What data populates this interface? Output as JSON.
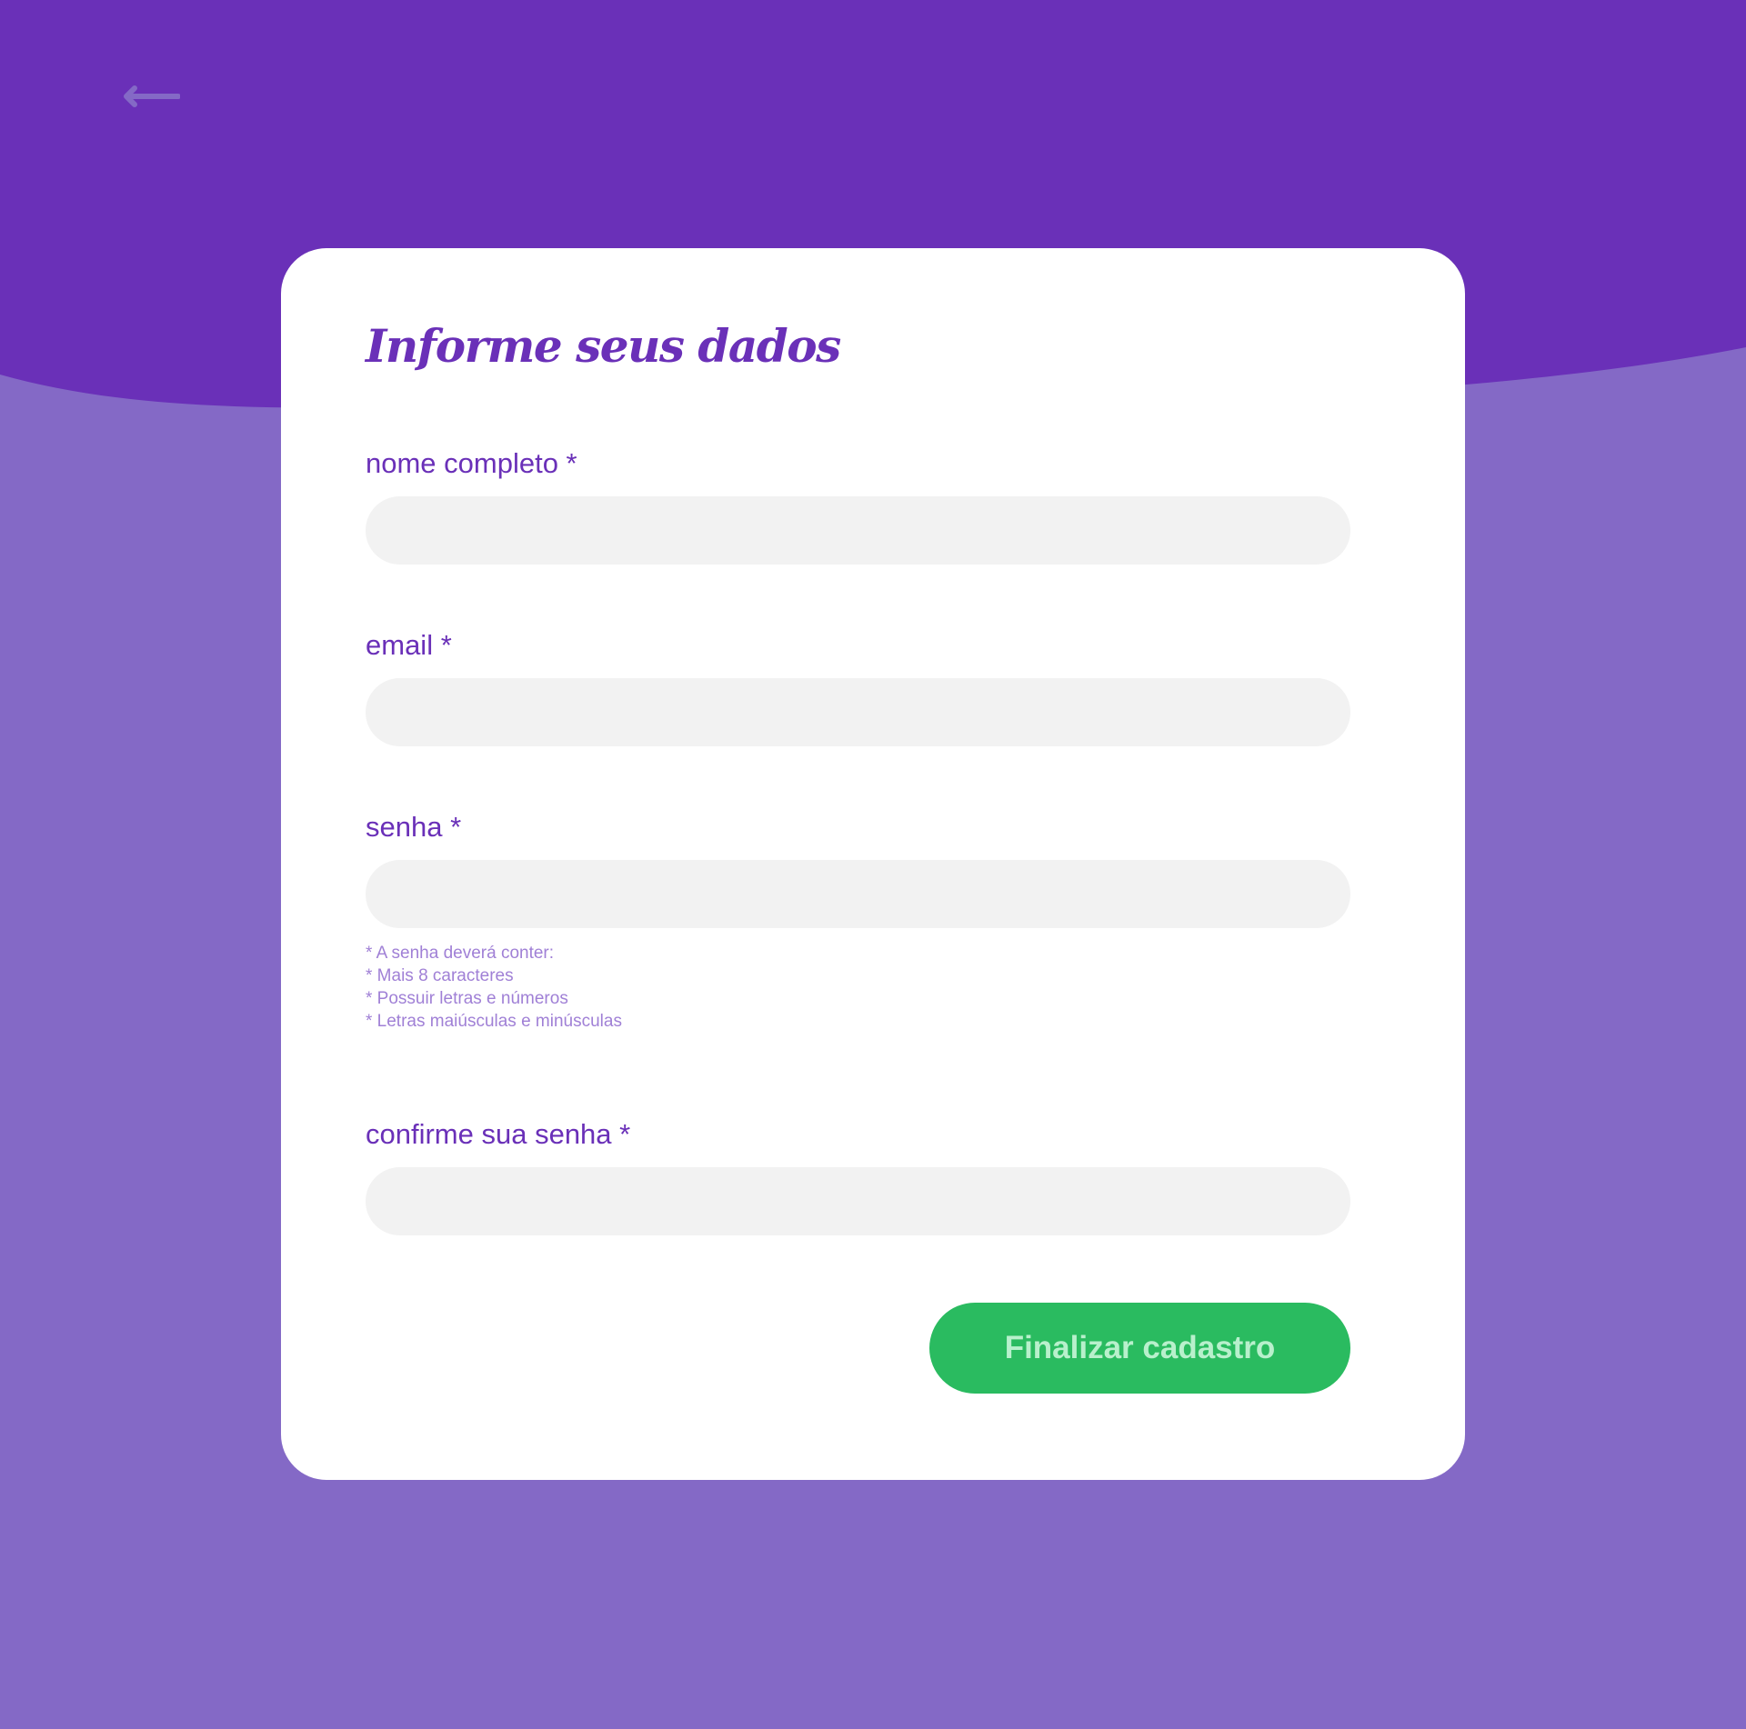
{
  "colors": {
    "header_purple": "#6a30b8",
    "background_purple": "#8469c6",
    "card_white": "#ffffff",
    "input_gray": "#f2f2f2",
    "accent_green": "#2abb60",
    "button_text_green": "#b8f0cc"
  },
  "header": {
    "back_icon": "arrow-left-icon"
  },
  "form": {
    "title": "Informe seus dados",
    "fields": [
      {
        "label": "nome completo *",
        "value": "",
        "placeholder": ""
      },
      {
        "label": "email *",
        "value": "",
        "placeholder": ""
      },
      {
        "label": "senha *",
        "value": "",
        "placeholder": ""
      },
      {
        "label": "confirme sua senha *",
        "value": "",
        "placeholder": ""
      }
    ],
    "password_hints": [
      "* A senha deverá conter:",
      "* Mais 8 caracteres",
      "* Possuir letras e números",
      "* Letras maiúsculas e minúsculas"
    ],
    "submit_label": "Finalizar cadastro"
  }
}
